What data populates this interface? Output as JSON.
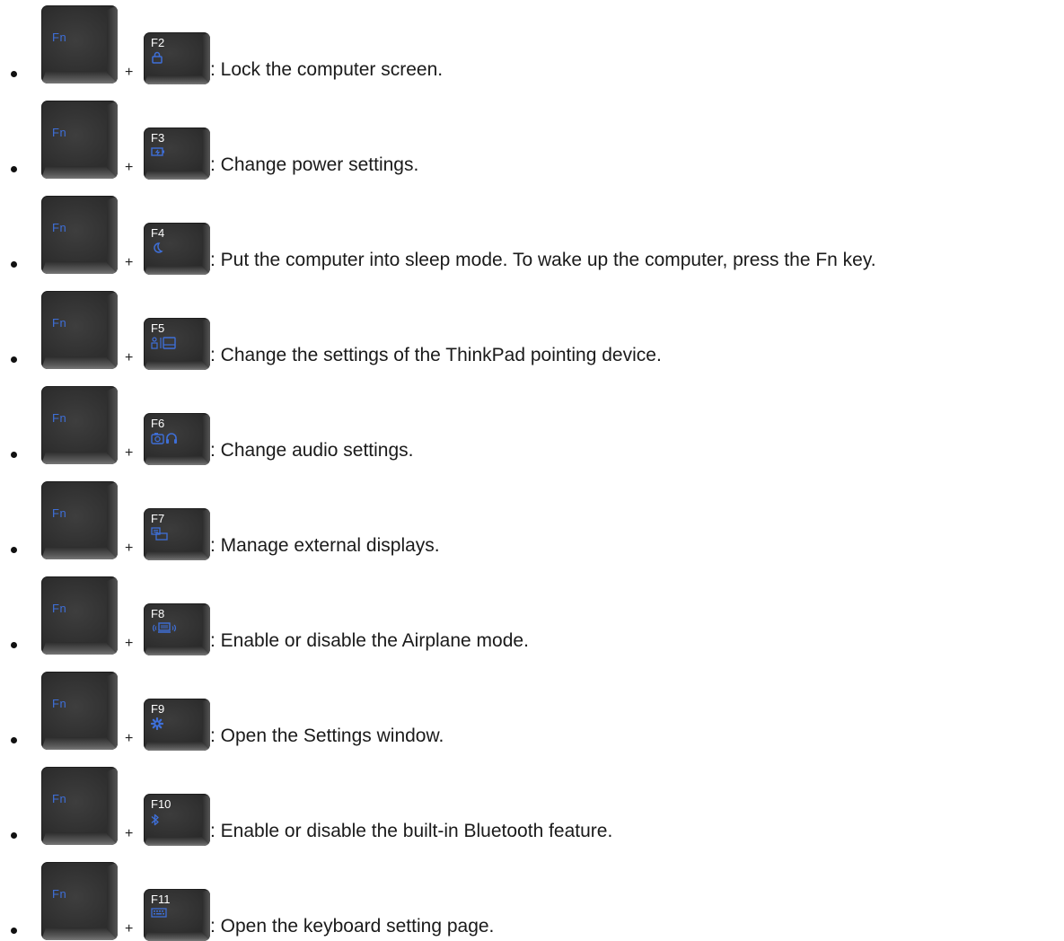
{
  "fn_key_label": "Fn",
  "plus_sign": "+",
  "icon_color": "#3e6fd8",
  "items": [
    {
      "key": "F2",
      "icon": "lock-icon",
      "description": ": Lock the computer screen."
    },
    {
      "key": "F3",
      "icon": "power-settings-icon",
      "description": ": Change power settings."
    },
    {
      "key": "F4",
      "icon": "sleep-moon-icon",
      "description": ": Put the computer into sleep mode. To wake up the computer, press the Fn key."
    },
    {
      "key": "F5",
      "icon": "pointing-device-icon",
      "description": ": Change the settings of the ThinkPad pointing device."
    },
    {
      "key": "F6",
      "icon": "camera-headset-icon",
      "description": ": Change audio settings."
    },
    {
      "key": "F7",
      "icon": "external-display-icon",
      "description": ": Manage external displays."
    },
    {
      "key": "F8",
      "icon": "airplane-mode-icon",
      "description": ": Enable or disable the Airplane mode."
    },
    {
      "key": "F9",
      "icon": "gear-icon",
      "description": ": Open the Settings window."
    },
    {
      "key": "F10",
      "icon": "bluetooth-icon",
      "description": ": Enable or disable the built-in Bluetooth feature."
    },
    {
      "key": "F11",
      "icon": "keyboard-icon",
      "description": ": Open the keyboard setting page."
    }
  ]
}
